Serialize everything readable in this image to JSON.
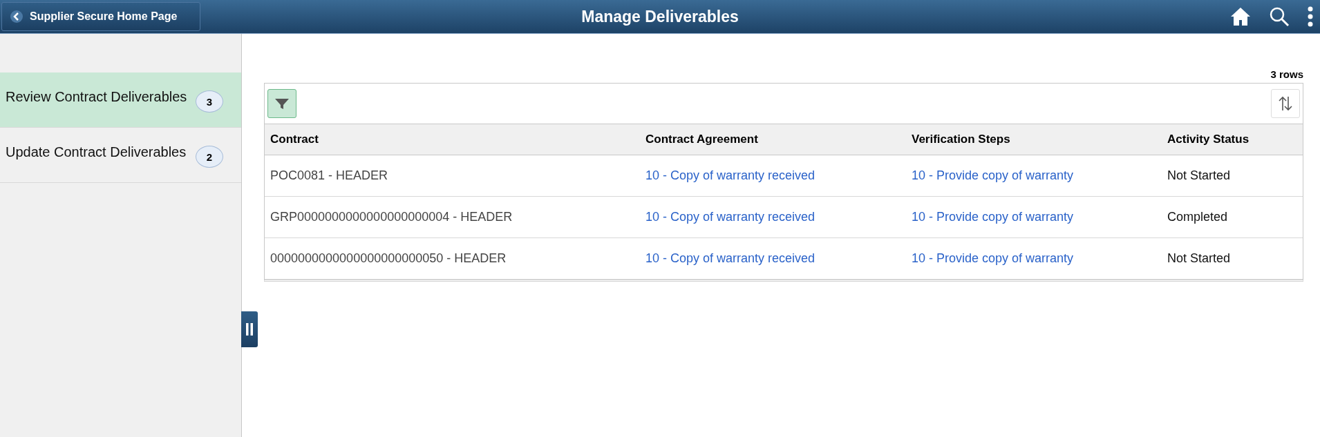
{
  "header": {
    "back_label": "Supplier Secure Home Page",
    "title": "Manage Deliverables"
  },
  "sidebar": {
    "items": [
      {
        "label": "Review Contract Deliverables",
        "count": "3",
        "selected": true
      },
      {
        "label": "Update Contract Deliverables",
        "count": "2",
        "selected": false
      }
    ]
  },
  "grid": {
    "row_count": "3 rows",
    "filter_active": true,
    "columns": [
      "Contract",
      "Contract Agreement",
      "Verification Steps",
      "Activity Status"
    ],
    "rows": [
      [
        "POC0081 - HEADER",
        "10 - Copy of warranty received",
        "10 - Provide copy of warranty",
        "Not Started"
      ],
      [
        "GRP0000000000000000000004 - HEADER",
        "10 - Copy of warranty received",
        "10 - Provide copy of warranty",
        "Completed"
      ],
      [
        "0000000000000000000000050 - HEADER",
        "10 - Copy of warranty received",
        "10 - Provide copy of warranty",
        "Not Started"
      ]
    ]
  }
}
